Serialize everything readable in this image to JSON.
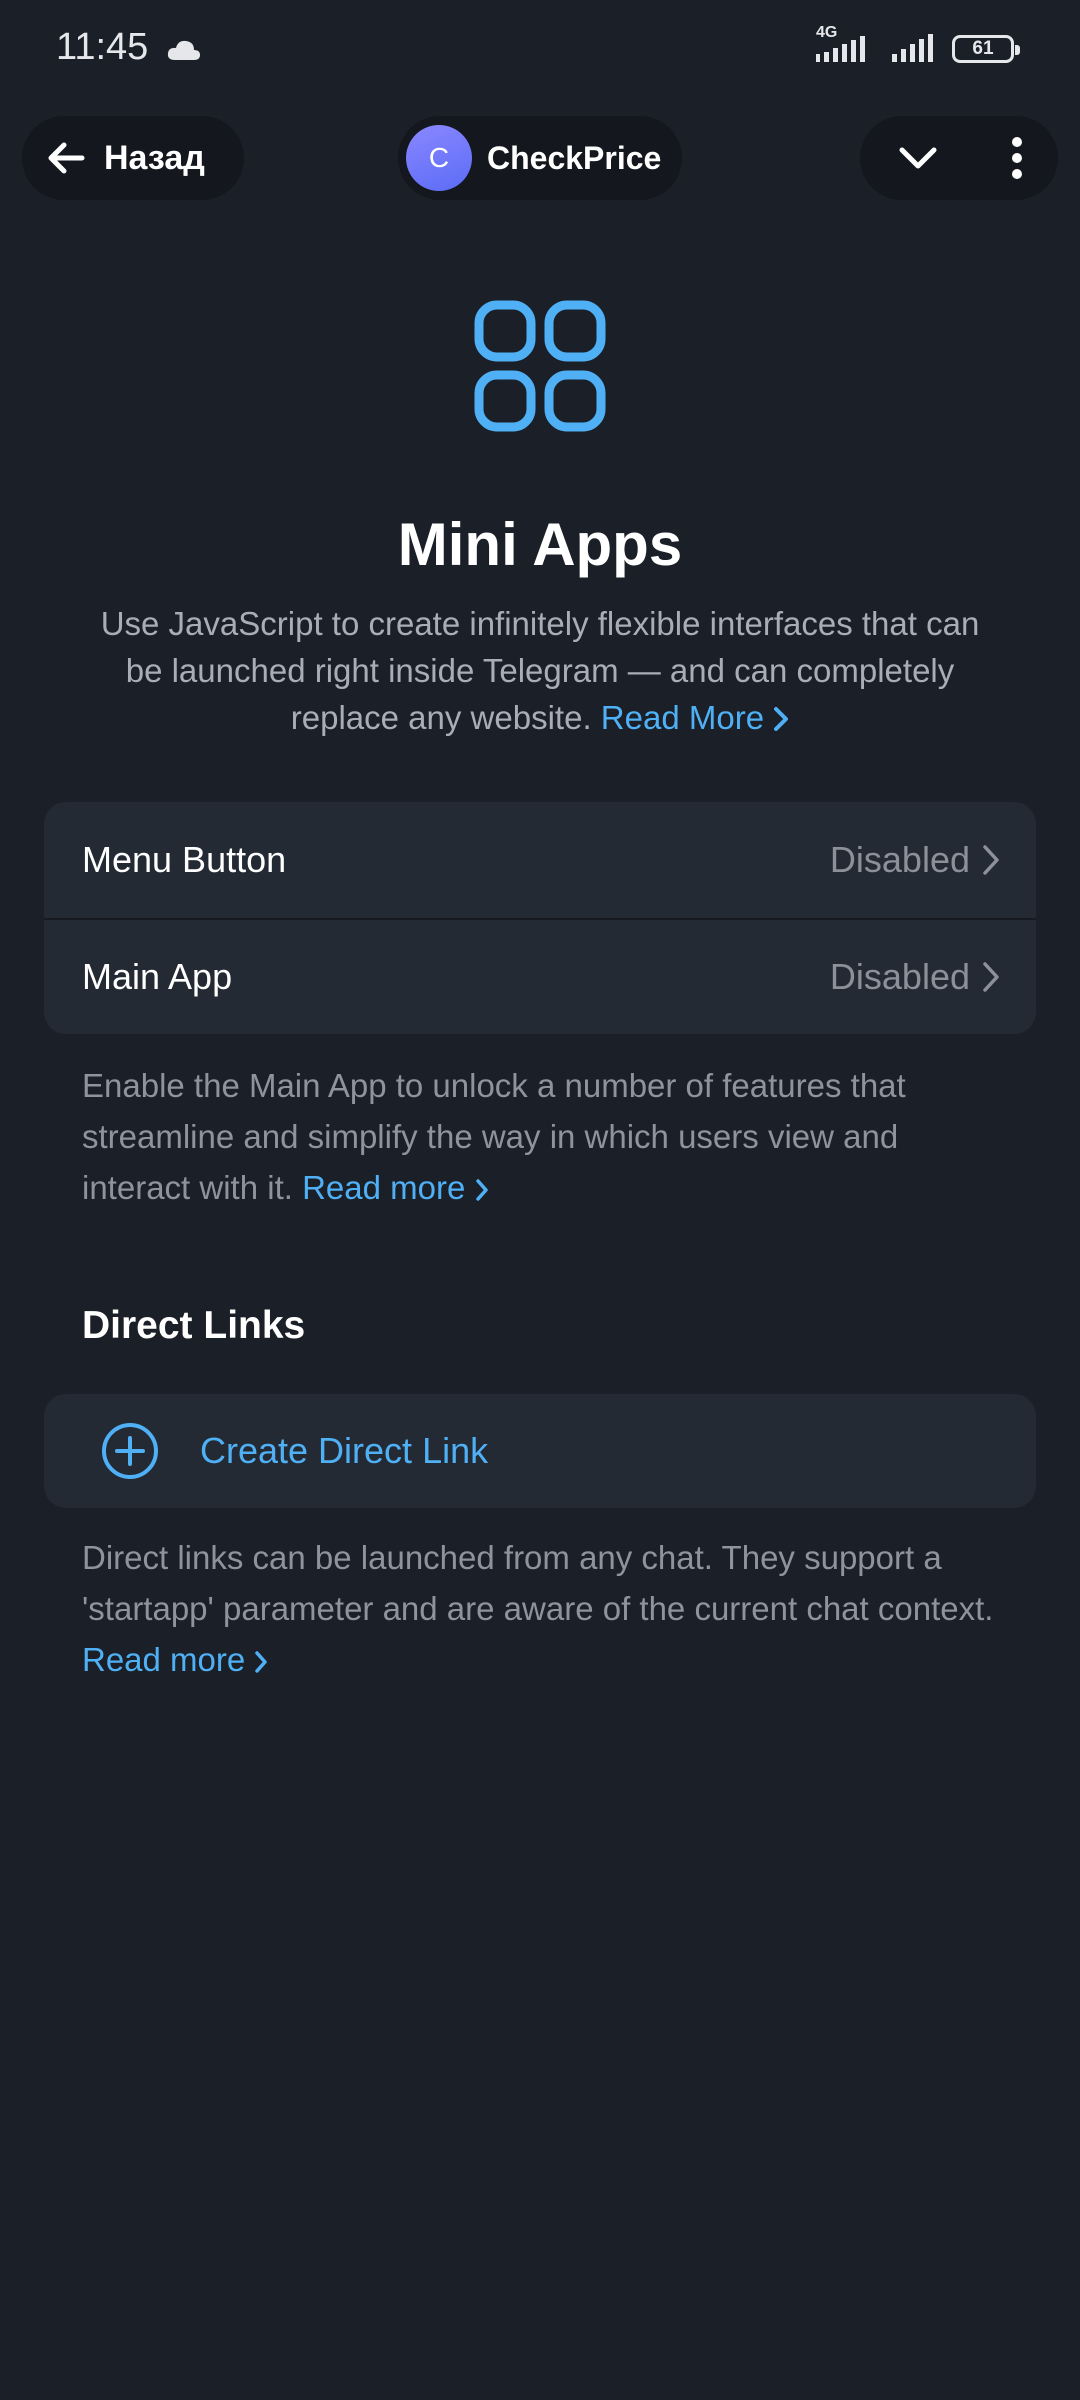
{
  "status_bar": {
    "time": "11:45",
    "network": "4G",
    "battery": "61",
    "icons": [
      "cloud-icon",
      "signal-icon",
      "signal-icon",
      "battery-icon"
    ]
  },
  "header": {
    "back_label": "Назад",
    "avatar_letter": "C",
    "title": "CheckPrice",
    "icons": [
      "arrow-left-icon",
      "chevron-down-icon",
      "more-vertical-icon"
    ]
  },
  "hero": {
    "icon": "mini-apps-grid-icon",
    "title": "Mini Apps",
    "description": "Use JavaScript to create infinitely flexible interfaces that can be launched right inside Telegram — and can completely replace any website.",
    "link": "Read More"
  },
  "settings": [
    {
      "label": "Menu Button",
      "value": "Disabled"
    },
    {
      "label": "Main App",
      "value": "Disabled"
    }
  ],
  "main_app_note": {
    "text": "Enable the Main App to unlock a number of features that streamline and simplify the way in which users view and interact with it.",
    "link": "Read more"
  },
  "direct_links": {
    "title": "Direct Links",
    "create_label": "Create Direct Link",
    "note": "Direct links can be launched from any chat. They support a 'startapp' parameter and are aware of the current chat context.",
    "link": "Read more"
  },
  "colors": {
    "background": "#1b1f27",
    "card": "#232a34",
    "accent": "#4fb0f5"
  }
}
